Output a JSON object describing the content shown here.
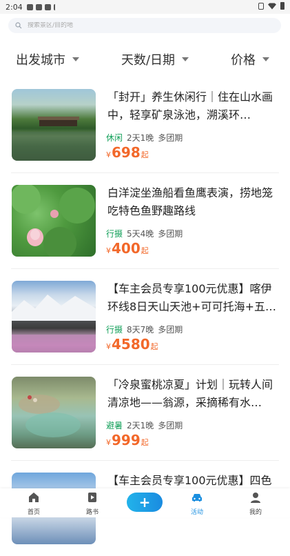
{
  "status_bar": {
    "time": "2:04"
  },
  "search": {
    "placeholder": "搜索景区/目的地"
  },
  "filters": [
    {
      "label": "出发城市"
    },
    {
      "label": "天数/日期"
    },
    {
      "label": "价格"
    }
  ],
  "items": [
    {
      "title": "「封开」养生休闲行｜住在山水画中，轻享矿泉泳池，溯溪环…",
      "category": "休闲",
      "duration": "2天1晚",
      "group": "多团期",
      "currency": "¥",
      "price": "698",
      "unit": "起"
    },
    {
      "title": "白洋淀坐渔船看鱼鹰表演，捞地笼吃特色鱼野趣路线",
      "category": "行摄",
      "duration": "5天4晚",
      "group": "多团期",
      "currency": "¥",
      "price": "400",
      "unit": "起"
    },
    {
      "title": "【车主会员专享100元优惠】喀伊环线8日天山天池+可可托海+五…",
      "category": "行摄",
      "duration": "8天7晚",
      "group": "多团期",
      "currency": "¥",
      "price": "4580",
      "unit": "起"
    },
    {
      "title": "「冷泉蜜桃凉夏」计划｜玩转人间清凉地——翁源，采摘稀有水…",
      "category": "避暑",
      "duration": "2天1晚",
      "group": "多团期",
      "currency": "¥",
      "price": "999",
      "unit": "起"
    },
    {
      "title": "【车主会员专享100元优惠】四色",
      "category": "",
      "duration": "",
      "group": "",
      "currency": "",
      "price": "",
      "unit": ""
    }
  ],
  "bottom_nav": [
    {
      "label": "首页",
      "icon": "home-icon"
    },
    {
      "label": "路书",
      "icon": "roadbook-icon"
    },
    {
      "label": "+",
      "icon": "plus-icon"
    },
    {
      "label": "活动",
      "icon": "car-icon"
    },
    {
      "label": "我的",
      "icon": "user-icon"
    }
  ],
  "colors": {
    "accent": "#1a8fe0",
    "price": "#f2682a",
    "category": "#13a05a"
  }
}
